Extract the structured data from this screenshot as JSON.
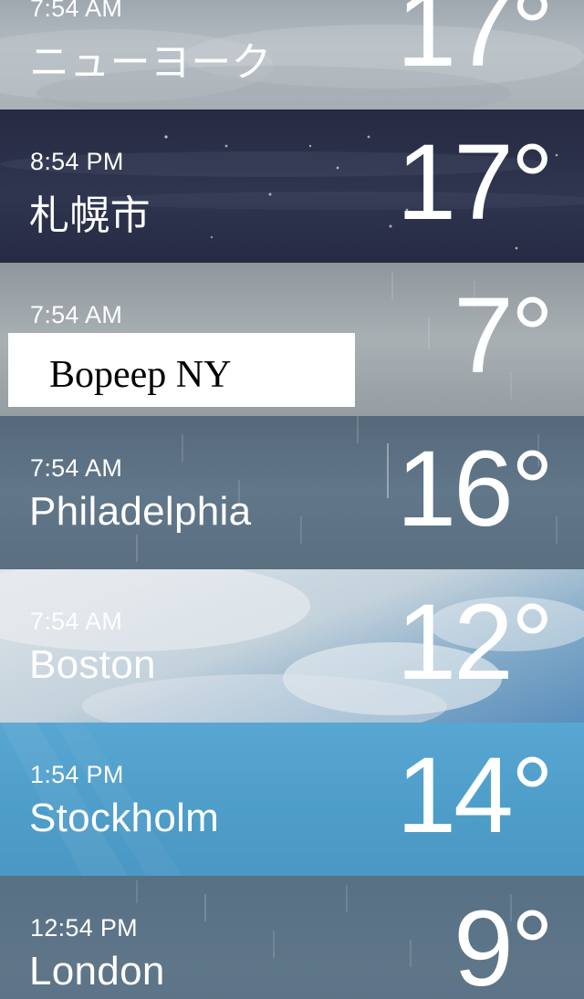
{
  "locations": [
    {
      "time": "7:54 AM",
      "city": "ニューヨーク",
      "temp": "17°"
    },
    {
      "time": "8:54 PM",
      "city": "札幌市",
      "temp": "17°"
    },
    {
      "time": "7:54 AM",
      "city": "",
      "temp": "7°"
    },
    {
      "time": "7:54 AM",
      "city": "Philadelphia",
      "temp": "16°"
    },
    {
      "time": "7:54 AM",
      "city": "Boston",
      "temp": "12°"
    },
    {
      "time": "1:54 PM",
      "city": "Stockholm",
      "temp": "14°"
    },
    {
      "time": "12:54 PM",
      "city": "London",
      "temp": "9°"
    }
  ],
  "overlay_label": "Bopeep NY",
  "row_backgrounds": {
    "newyork": "#a7b0b7",
    "sapporo": "#2b304a",
    "bopeep": "#a2a9ad",
    "philadelphia": "#5c7181",
    "boston": "#c9d6de",
    "stockholm": "#4f9ec9",
    "london": "#5c7287"
  }
}
